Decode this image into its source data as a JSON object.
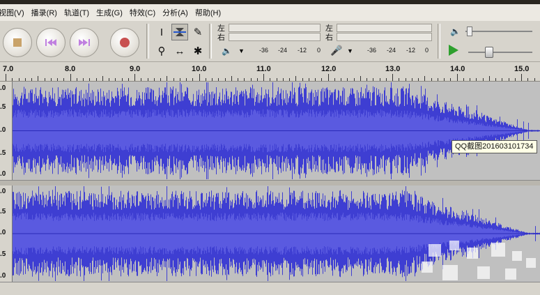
{
  "menu": [
    "视图(V)",
    "播录(R)",
    "轨道(T)",
    "生成(G)",
    "特效(C)",
    "分析(A)",
    "帮助(H)"
  ],
  "meter": {
    "left": "左",
    "right": "右",
    "ticks_a": [
      "-36",
      "-24",
      "-12",
      "0"
    ],
    "ticks_b": [
      "-36",
      "-24",
      "-12",
      "0"
    ]
  },
  "ruler": [
    "7.0",
    "8.0",
    "9.0",
    "10.0",
    "11.0",
    "12.0",
    "13.0",
    "14.0",
    "15.0"
  ],
  "track_scale": [
    ".0",
    ".5",
    ".0",
    ".5",
    ".0"
  ],
  "tooltip": "QQ截图201603101734",
  "colors": {
    "waveform": "#3e3ed2",
    "waveform_dark": "#2a2ab8",
    "track_bg": "#c0c0c0"
  }
}
